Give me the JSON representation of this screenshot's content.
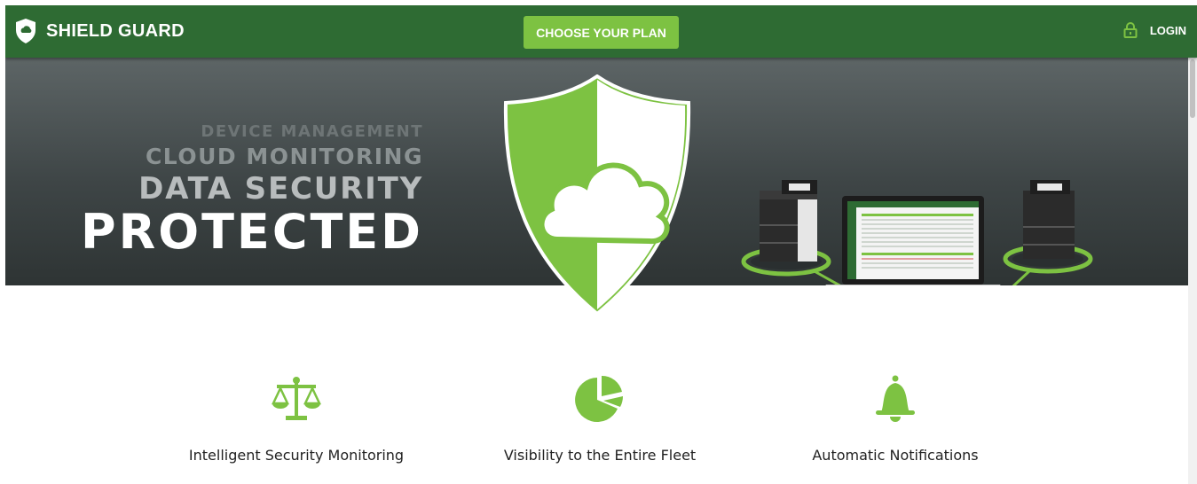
{
  "header": {
    "brand_name": "SHIELD GUARD",
    "cta_label": "CHOOSE YOUR PLAN",
    "login_label": "LOGIN"
  },
  "hero": {
    "lines": [
      "DEVICE MANAGEMENT",
      "CLOUD MONITORING",
      "DATA SECURITY",
      "PROTECTED"
    ]
  },
  "features": [
    {
      "icon": "scales-icon",
      "title": "Intelligent Security Monitoring"
    },
    {
      "icon": "pie-chart-icon",
      "title": "Visibility to the Entire Fleet"
    },
    {
      "icon": "bell-icon",
      "title": "Automatic Notifications"
    }
  ],
  "colors": {
    "nav_bg": "#2e6b33",
    "accent": "#7dc242",
    "hero_bg": "#3e4546"
  }
}
